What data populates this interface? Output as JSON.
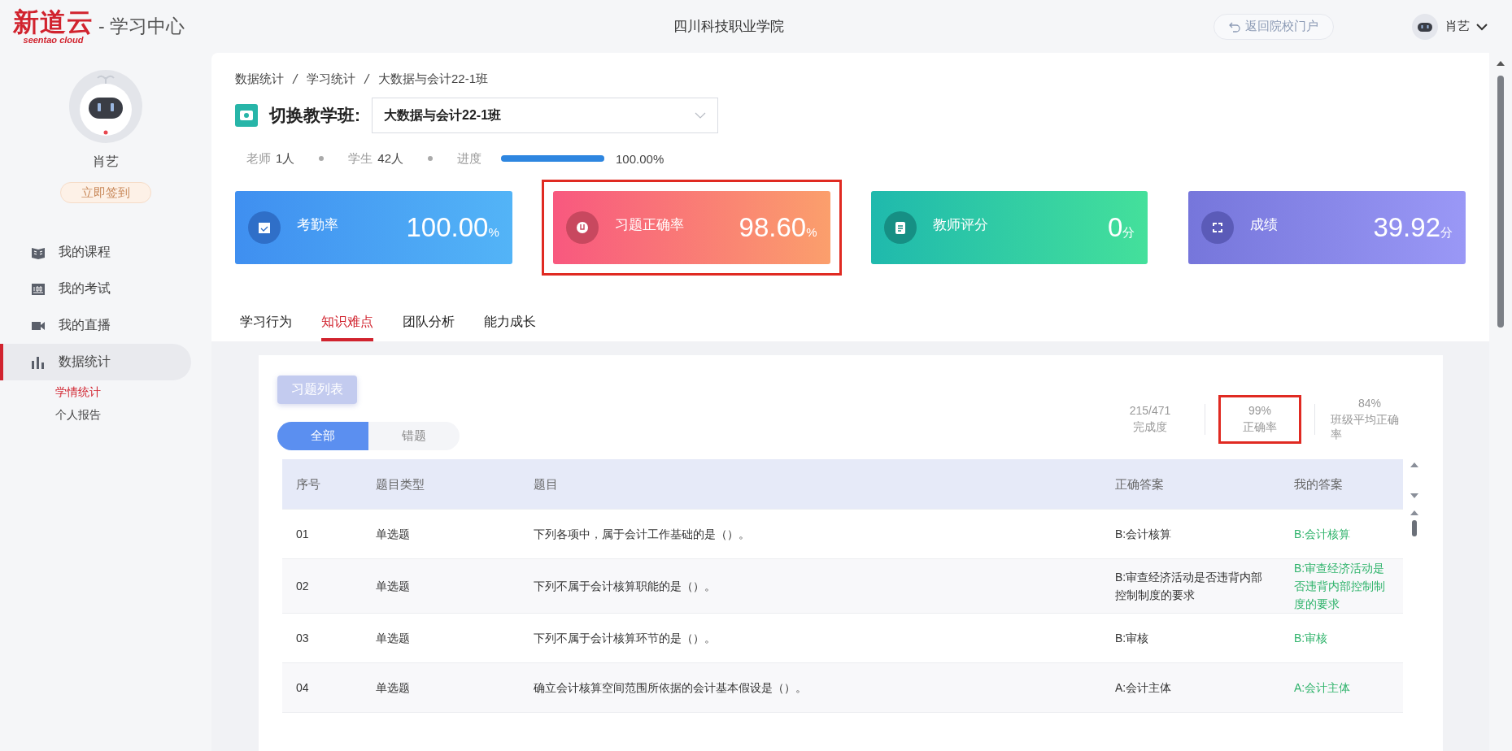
{
  "header": {
    "brand": "新道云",
    "brand_sub": "seentao cloud",
    "product": "- 学习中心",
    "school": "四川科技职业学院",
    "back_button": "返回院校门户",
    "user_name": "肖艺"
  },
  "sidebar": {
    "profile_name": "肖艺",
    "checkin_button": "立即签到",
    "items": [
      {
        "kind": "course",
        "label": "我的课程",
        "selected": false
      },
      {
        "kind": "exam",
        "label": "我的考试",
        "selected": false
      },
      {
        "kind": "live",
        "label": "我的直播",
        "selected": false
      },
      {
        "kind": "stats",
        "label": "数据统计",
        "selected": true,
        "children": [
          {
            "label": "学情统计",
            "selected": true
          },
          {
            "label": "个人报告",
            "selected": false
          }
        ]
      }
    ]
  },
  "breadcrumb": [
    "数据统计",
    "学习统计",
    "大数据与会计22-1班"
  ],
  "class_switch": {
    "label": "切换教学班:",
    "value": "大数据与会计22-1班"
  },
  "summary": {
    "teacher_label": "老师",
    "teacher_count": "1人",
    "student_label": "学生",
    "student_count": "42人",
    "progress_label": "进度",
    "level": 1.0,
    "progress_text": "100.00%"
  },
  "cards": [
    {
      "kind": "attendance",
      "label": "考勤率",
      "value": "100.00",
      "unit": "%",
      "highlighted": false
    },
    {
      "kind": "accuracy",
      "label": "习题正确率",
      "value": "98.60",
      "unit": "%",
      "highlighted": true
    },
    {
      "kind": "teacher",
      "label": "教师评分",
      "value": "0",
      "unit": "分",
      "highlighted": false
    },
    {
      "kind": "score",
      "label": "成绩",
      "value": "39.92",
      "unit": "分",
      "highlighted": false
    }
  ],
  "tabs": [
    {
      "label": "学习行为",
      "selected": false
    },
    {
      "label": "知识难点",
      "selected": true
    },
    {
      "label": "团队分析",
      "selected": false
    },
    {
      "label": "能力成长",
      "selected": false
    }
  ],
  "exercise_list_button": "习题列表",
  "filters": [
    {
      "label": "全部",
      "selected": true
    },
    {
      "label": "错题",
      "selected": false
    }
  ],
  "stats": [
    {
      "value": "215/471",
      "label": "完成度",
      "highlighted": false
    },
    {
      "value": "99%",
      "label": "正确率",
      "highlighted": true
    },
    {
      "value": "84%",
      "label": "班级平均正确率",
      "highlighted": false
    }
  ],
  "table": {
    "columns": [
      "序号",
      "题目类型",
      "题目",
      "正确答案",
      "我的答案"
    ],
    "rows": [
      {
        "no": "01",
        "type": "单选题",
        "question": "下列各项中，属于会计工作基础的是（）。",
        "correct": "B:会计核算",
        "mine": "B:会计核算"
      },
      {
        "no": "02",
        "type": "单选题",
        "question": "下列不属于会计核算职能的是（）。",
        "correct": "B:审查经济活动是否违背内部控制制度的要求",
        "mine": "B:审查经济活动是否违背内部控制制度的要求"
      },
      {
        "no": "03",
        "type": "单选题",
        "question": "下列不属于会计核算环节的是（）。",
        "correct": "B:审核",
        "mine": "B:审核"
      },
      {
        "no": "04",
        "type": "单选题",
        "question": "确立会计核算空间范围所依据的会计基本假设是（）。",
        "correct": "A:会计主体",
        "mine": "A:会计主体"
      }
    ]
  }
}
